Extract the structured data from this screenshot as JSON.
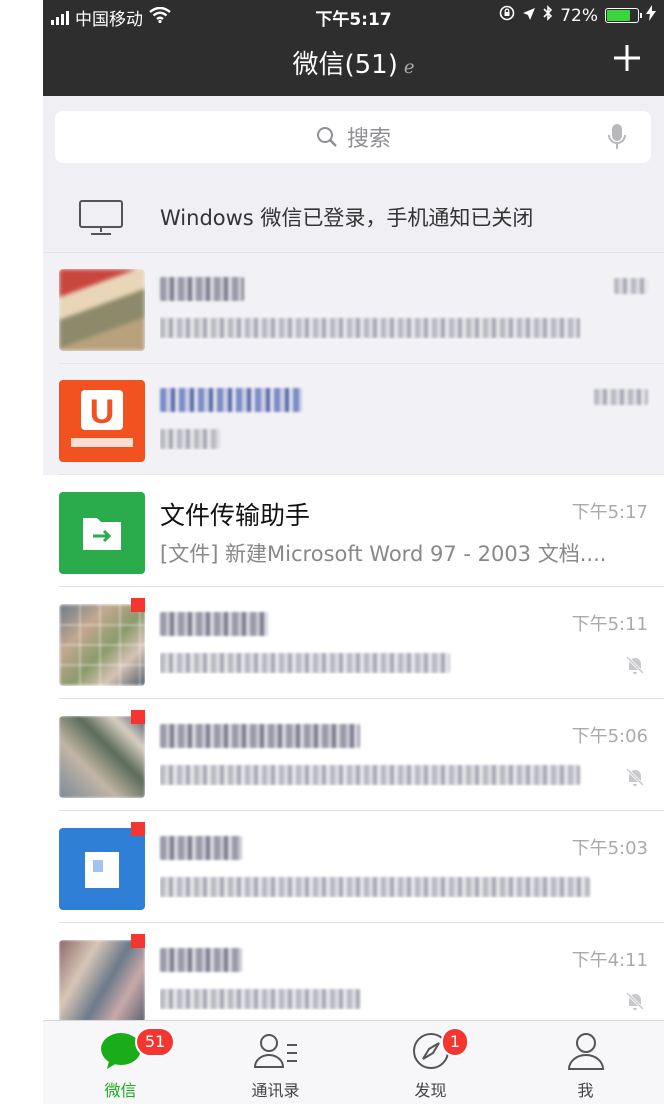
{
  "status": {
    "carrier": "中国移动",
    "time": "下午5:17",
    "battery": "72%",
    "battery_level": 0.72
  },
  "header": {
    "title": "微信(51)",
    "icons": [
      "ear-icon",
      "plus-icon"
    ]
  },
  "search": {
    "placeholder": "搜索"
  },
  "notice": {
    "text": "Windows 微信已登录，手机通知已关闭"
  },
  "chats": [
    {
      "name": "",
      "message": "",
      "time": "",
      "pinned": true,
      "avatar": "blurred-photo"
    },
    {
      "name": "",
      "message": "",
      "time": "",
      "pinned": true,
      "avatar": "orange-u-logo"
    },
    {
      "name": "文件传输助手",
      "message": "[文件] 新建Microsoft Word 97 - 2003 文档....",
      "time": "下午5:17",
      "pinned": false,
      "avatar": "file-transfer-icon"
    },
    {
      "name": "",
      "message": "",
      "time": "下午5:11",
      "pinned": false,
      "muted": true,
      "avatar": "blurred-group"
    },
    {
      "name": "",
      "message": "",
      "time": "下午5:06",
      "pinned": false,
      "muted": true,
      "avatar": "blurred-group"
    },
    {
      "name": "",
      "message": "",
      "time": "下午5:03",
      "pinned": false,
      "muted": false,
      "avatar": "blue-square"
    },
    {
      "name": "",
      "message": "",
      "time": "下午4:11",
      "pinned": false,
      "muted": true,
      "avatar": "blurred-group"
    }
  ],
  "tabs": [
    {
      "label": "微信",
      "badge": "51",
      "active": true
    },
    {
      "label": "通讯录"
    },
    {
      "label": "发现",
      "badge": "1"
    },
    {
      "label": "我"
    }
  ],
  "colors": {
    "accent": "#1aad19",
    "badge": "#f43530",
    "header": "#2e2e2e"
  }
}
